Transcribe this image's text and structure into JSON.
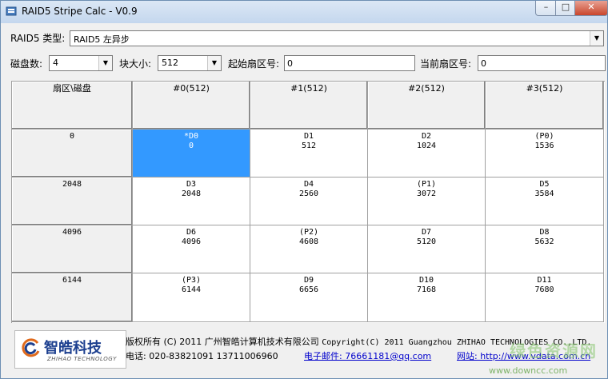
{
  "window": {
    "title": "RAID5 Stripe Calc - V0.9",
    "min_glyph": "–",
    "max_glyph": "□",
    "close_glyph": "✕"
  },
  "controls": {
    "raid_type_label": "RAID5 类型:",
    "raid_type_value": "RAID5 左异步",
    "disk_count_label": "磁盘数:",
    "disk_count_value": "4",
    "block_size_label": "块大小:",
    "block_size_value": "512",
    "start_sector_label": "起始扇区号:",
    "start_sector_value": "0",
    "current_sector_label": "当前扇区号:",
    "current_sector_value": "0"
  },
  "table": {
    "corner_header": "扇区\\磁盘",
    "disk_headers": [
      "#0(512)",
      "#1(512)",
      "#2(512)",
      "#3(512)"
    ],
    "rows": [
      {
        "sector": "0",
        "cells": [
          [
            "*D0",
            "0"
          ],
          [
            "D1",
            "512"
          ],
          [
            "D2",
            "1024"
          ],
          [
            "(P0)",
            "1536"
          ]
        ]
      },
      {
        "sector": "2048",
        "cells": [
          [
            "D3",
            "2048"
          ],
          [
            "D4",
            "2560"
          ],
          [
            "(P1)",
            "3072"
          ],
          [
            "D5",
            "3584"
          ]
        ]
      },
      {
        "sector": "4096",
        "cells": [
          [
            "D6",
            "4096"
          ],
          [
            "(P2)",
            "4608"
          ],
          [
            "D7",
            "5120"
          ],
          [
            "D8",
            "5632"
          ]
        ]
      },
      {
        "sector": "6144",
        "cells": [
          [
            "(P3)",
            "6144"
          ],
          [
            "D9",
            "6656"
          ],
          [
            "D10",
            "7168"
          ],
          [
            "D11",
            "7680"
          ]
        ]
      }
    ]
  },
  "footer": {
    "logo_cn": "智皓科技",
    "logo_en": "ZHIHAO TECHNOLOGY",
    "copyright_cn": "版权所有 (C) 2011 广州智皓计算机技术有限公司",
    "copyright_en": "Copyright(C) 2011 Guangzhou ZHIHAO TECHNOLOGIES CO.,LTD.",
    "phone": "电话: 020-83821091 13711006960",
    "email": "电子邮件: 76661181@qq.com",
    "website": "网站: http://www.vdata.com.cn"
  },
  "watermark": {
    "text": "www.downcc.com",
    "logo": "绿色资源网"
  },
  "colors": {
    "selected": "#3399ff",
    "link": "#0000cc"
  }
}
